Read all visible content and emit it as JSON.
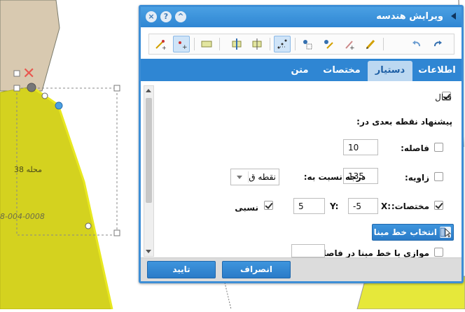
{
  "map": {
    "parcel_label": "محله 38",
    "parcel_code": "8-004-0008",
    "colors": {
      "parcel_fill": "#d4d21f",
      "neighbor_fill": "#d8c9b0",
      "selection": "#4aa0e3"
    }
  },
  "dialog": {
    "title": "ویرایش هندسه",
    "title_buttons": {
      "close": "×",
      "help": "?",
      "collapse": "^"
    },
    "toolbar_icons": [
      "redo-icon",
      "undo-icon",
      "pencil-icon",
      "add-vertex-icon",
      "edit-vertex-icon",
      "vertex-settings-icon",
      "snapping-icon",
      "split-icon",
      "merge-icon",
      "rectangle-icon",
      "add-point-icon",
      "draw-line-icon"
    ],
    "tabs": [
      {
        "label": "اطلاعات",
        "active": false
      },
      {
        "label": "دستیار",
        "active": true
      },
      {
        "label": "مختصات",
        "active": false
      },
      {
        "label": "متن",
        "active": false
      }
    ],
    "assistant": {
      "enabled_label": "فعال",
      "enabled_checked": true,
      "suggest_heading": "پیشنهاد نقطه بعدی در:",
      "distance_label": "فاصله:",
      "distance_checked": false,
      "distance_value": "10",
      "angle_label": "زاویه:",
      "angle_checked": false,
      "angle_value": "135",
      "angle_relative_label": "درجه نسبت به:",
      "angle_relative_select": "نقطه ق",
      "coords_label": "مختصات:",
      "coords_checked": true,
      "x_label": "X:",
      "x_value": "-5",
      "y_label": "Y:",
      "y_value": "5",
      "relative_label": "نسبی",
      "relative_checked": true,
      "baseline_button": "انتخاب خط مبنا",
      "parallel_label": "موازی با خط مبنا در فاصله:",
      "parallel_checked": false,
      "parallel_value": ""
    },
    "footer": {
      "cancel": "انصراف",
      "confirm": "تایید"
    }
  }
}
